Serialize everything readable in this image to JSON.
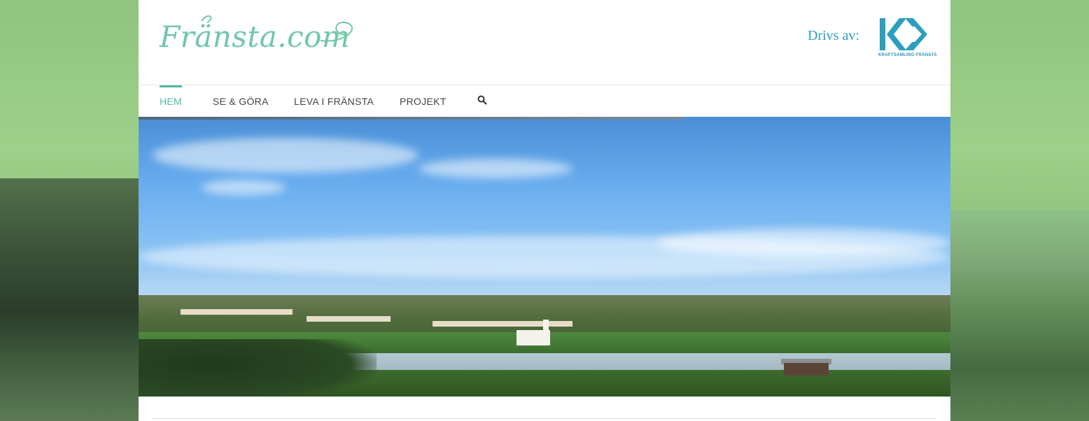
{
  "header": {
    "logo_text": "Fränsta.com",
    "drivs_label": "Drivs av:",
    "partner_logo_caption": "KRAFTSAMLING FRÄNSTA"
  },
  "nav": {
    "items": [
      {
        "label": "HEM",
        "active": true
      },
      {
        "label": "SE & GÖRA",
        "active": false
      },
      {
        "label": "LEVA I FRÄNSTA",
        "active": false
      },
      {
        "label": "PROJEKT",
        "active": false
      }
    ],
    "search_icon": "search-icon"
  },
  "colors": {
    "accent": "#4fb9a8",
    "logo": "#6fc8a6",
    "partner": "#2b9fbe",
    "nav_text": "#444444"
  }
}
